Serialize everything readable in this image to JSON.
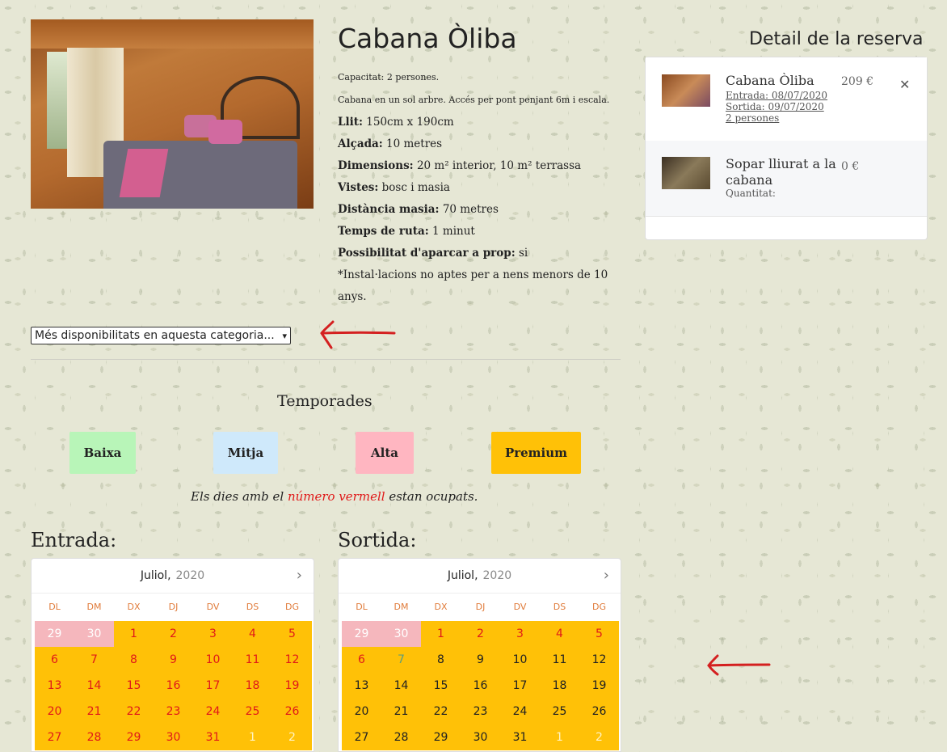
{
  "product": {
    "title": "Cabana Òliba",
    "capacity": "Capacitat: 2 persones.",
    "summary": "Cabana en un sol arbre. Accés per pont penjant 6m i escala.",
    "features": [
      {
        "label": "Llit:",
        "value": " 150cm x 190cm"
      },
      {
        "label": "Alçada:",
        "value": " 10 metres"
      },
      {
        "label": "Dimensions:",
        "value": " 20 m² interior, 10 m² terrassa"
      },
      {
        "label": "Vistes:",
        "value": " bosc i masia"
      },
      {
        "label": "Distància masia:",
        "value": " 70 metres"
      },
      {
        "label": "Temps de ruta:",
        "value": " 1 minut"
      },
      {
        "label": "Possibilitat d'aparcar a prop:",
        "value": " si"
      }
    ],
    "warning": "*Instal·lacions no aptes per a nens menors de 10 anys."
  },
  "availability_select": {
    "value": "Més disponibilitats en aquesta categoria..."
  },
  "seasons": {
    "title": "Temporades",
    "items": [
      {
        "label": "Baixa",
        "color": "#b8f5b8"
      },
      {
        "label": "Mitja",
        "color": "#cfe9fb"
      },
      {
        "label": "Alta",
        "color": "#ffb6c1"
      },
      {
        "label": "Premium",
        "color": "#ffc107"
      }
    ],
    "note_pre": "Els dies amb el ",
    "note_red": "número vermell",
    "note_post": " estan ocupats."
  },
  "calendars": {
    "entry_label": "Entrada:",
    "exit_label": "Sortida:",
    "month": "Juliol,",
    "year": "2020",
    "weekdays": [
      "DL",
      "DM",
      "DX",
      "DJ",
      "DV",
      "DS",
      "DG"
    ]
  },
  "booking": {
    "title": "Detail de la reserva",
    "items": [
      {
        "name": "Cabana Òliba",
        "price": "209 €",
        "entry": "Entrada: 08/07/2020",
        "exit": "Sortida: 09/07/2020",
        "people": "2 persones"
      },
      {
        "name": "Sopar lliurat a la cabana",
        "price": "0 €",
        "quantity": "Quantitat:"
      }
    ]
  },
  "colors": {
    "accent": "#ffc107",
    "busy": "#e01919",
    "arrow": "#d42020"
  }
}
